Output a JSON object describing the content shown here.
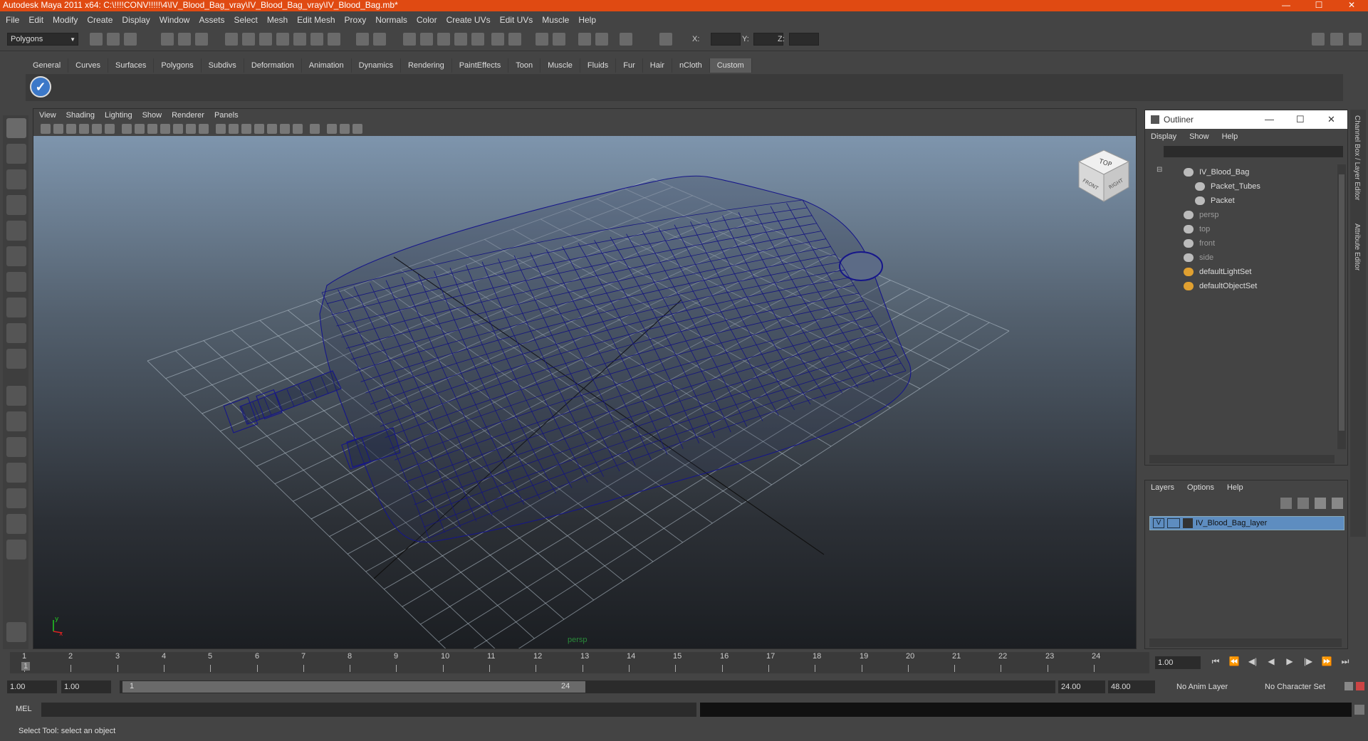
{
  "window": {
    "title": "Autodesk Maya 2011 x64: C:\\!!!!CONV!!!!!\\4\\IV_Blood_Bag_vray\\IV_Blood_Bag_vray\\IV_Blood_Bag.mb*",
    "minimize_icon": "minimize-icon",
    "maximize_icon": "maximize-icon",
    "close_icon": "close-icon"
  },
  "menubar": [
    "File",
    "Edit",
    "Modify",
    "Create",
    "Display",
    "Window",
    "Assets",
    "Select",
    "Mesh",
    "Edit Mesh",
    "Proxy",
    "Normals",
    "Color",
    "Create UVs",
    "Edit UVs",
    "Muscle",
    "Help"
  ],
  "statusline": {
    "menu_set": "Polygons",
    "x_label": "X:",
    "y_label": "Y:",
    "z_label": "Z:"
  },
  "shelf": {
    "tabs": [
      "General",
      "Curves",
      "Surfaces",
      "Polygons",
      "Subdivs",
      "Deformation",
      "Animation",
      "Dynamics",
      "Rendering",
      "PaintEffects",
      "Toon",
      "Muscle",
      "Fluids",
      "Fur",
      "Hair",
      "nCloth",
      "Custom"
    ],
    "active_tab": "Custom",
    "button_icon": "checkmark-icon"
  },
  "panel": {
    "menu": [
      "View",
      "Shading",
      "Lighting",
      "Show",
      "Renderer",
      "Panels"
    ],
    "camera_label": "persp",
    "viewcube": {
      "top": "TOP",
      "front": "FRONT",
      "right": "RIGHT"
    },
    "axis": {
      "x": "x",
      "y": "y"
    }
  },
  "outliner": {
    "title": "Outliner",
    "menu": [
      "Display",
      "Show",
      "Help"
    ],
    "items": [
      {
        "label": "IV_Blood_Bag",
        "dim": false,
        "icon": "transform-icon"
      },
      {
        "label": "Packet_Tubes",
        "dim": false,
        "icon": "mesh-icon"
      },
      {
        "label": "Packet",
        "dim": false,
        "icon": "mesh-icon"
      },
      {
        "label": "persp",
        "dim": true,
        "icon": "camera-icon"
      },
      {
        "label": "top",
        "dim": true,
        "icon": "camera-icon"
      },
      {
        "label": "front",
        "dim": true,
        "icon": "camera-icon"
      },
      {
        "label": "side",
        "dim": true,
        "icon": "camera-icon"
      },
      {
        "label": "defaultLightSet",
        "dim": false,
        "icon": "set-icon"
      },
      {
        "label": "defaultObjectSet",
        "dim": false,
        "icon": "set-icon"
      }
    ]
  },
  "layers": {
    "menu": [
      "Layers",
      "Options",
      "Help"
    ],
    "layer": {
      "visible": "V",
      "name": "IV_Blood_Bag_layer"
    }
  },
  "sidetabs": [
    "Channel Box / Layer Editor",
    "Attribute Editor"
  ],
  "timeslider": {
    "frames": [
      "1",
      "2",
      "3",
      "4",
      "5",
      "6",
      "7",
      "8",
      "9",
      "10",
      "11",
      "12",
      "13",
      "14",
      "15",
      "16",
      "17",
      "18",
      "19",
      "20",
      "21",
      "22",
      "23",
      "24"
    ],
    "current_frame_marker": "1",
    "current_time": "1.00"
  },
  "rangebar": {
    "start": "1.00",
    "playback_start": "1.00",
    "slider_start": "1",
    "slider_end": "24",
    "playback_end": "24.00",
    "end": "48.00",
    "anim_layer": "No Anim Layer",
    "character_set": "No Character Set"
  },
  "cmdline": {
    "label": "MEL"
  },
  "helpline": {
    "text": "Select Tool: select an object"
  }
}
